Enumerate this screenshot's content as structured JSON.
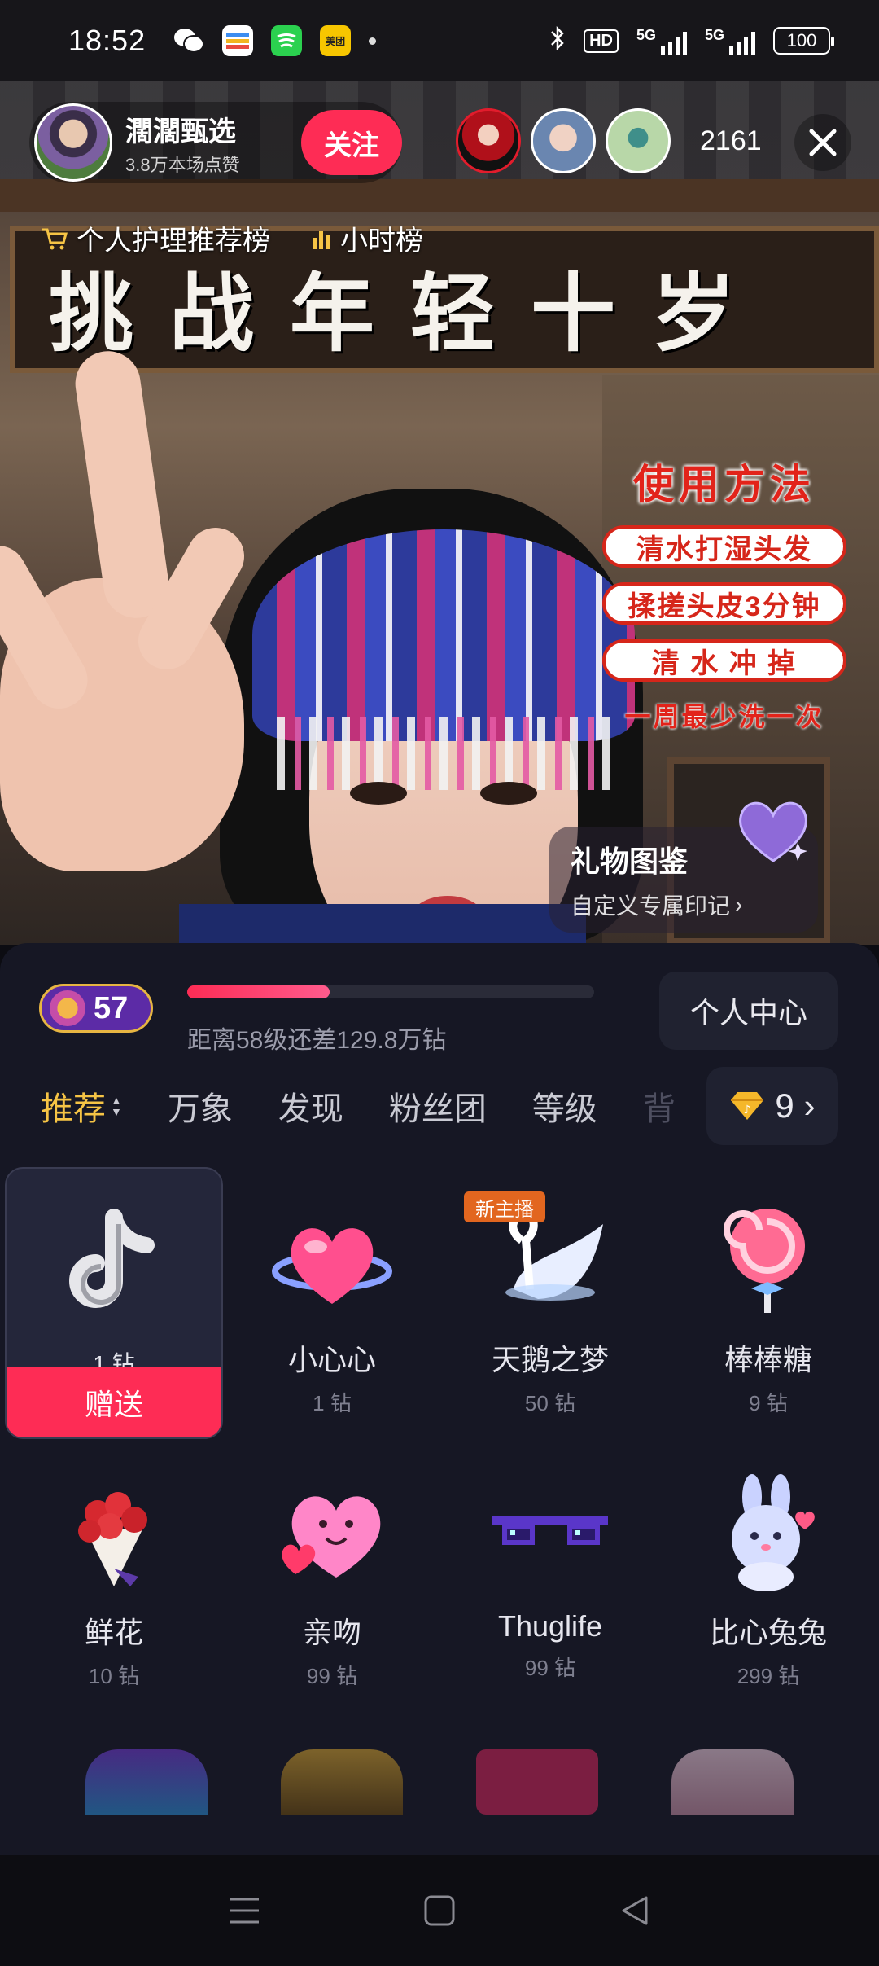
{
  "status_bar": {
    "time": "18:52",
    "hd": "HD",
    "signal_labels": [
      "5G",
      "5G"
    ],
    "battery": "100"
  },
  "host": {
    "name": "濶濶甄选",
    "likes": "3.8万本场点赞",
    "follow_label": "关注"
  },
  "viewer_count": "2161",
  "ranks": {
    "category": "个人护理推荐榜",
    "hourly": "小时榜"
  },
  "stream_overlay": {
    "banner_title": "挑战年轻十岁",
    "usage_title": "使用方法",
    "steps": [
      "清水打湿头发",
      "揉搓头皮3分钟",
      "清 水 冲 掉"
    ],
    "note": "一周最少洗一次"
  },
  "gift_promo": {
    "title": "礼物图鉴",
    "subtitle": "自定义专属印记"
  },
  "panel": {
    "level": "57",
    "progress": 0.35,
    "progress_text": "距离58级还差129.8万钻",
    "center_label": "个人中心",
    "diamond_count": "9",
    "tabs": [
      "推荐",
      "万象",
      "发现",
      "粉丝团",
      "等级",
      "背"
    ],
    "send_label": "赠送",
    "new_tag": "新主播"
  },
  "gifts": [
    {
      "name": "",
      "price": "1 钻",
      "icon": "douyin-logo-icon"
    },
    {
      "name": "小心心",
      "price": "1 钻",
      "icon": "heart-icon"
    },
    {
      "name": "天鹅之梦",
      "price": "50 钻",
      "icon": "swan-icon"
    },
    {
      "name": "棒棒糖",
      "price": "9 钻",
      "icon": "lollipop-icon"
    },
    {
      "name": "鲜花",
      "price": "10 钻",
      "icon": "flowers-icon"
    },
    {
      "name": "亲吻",
      "price": "99 钻",
      "icon": "kiss-heart-icon"
    },
    {
      "name": "Thuglife",
      "price": "99 钻",
      "icon": "sunglasses-icon"
    },
    {
      "name": "比心兔兔",
      "price": "299 钻",
      "icon": "bunny-icon"
    }
  ],
  "colors": {
    "accent": "#fe2c55",
    "active_tab": "#f6c445",
    "panel_bg": "#161724"
  }
}
